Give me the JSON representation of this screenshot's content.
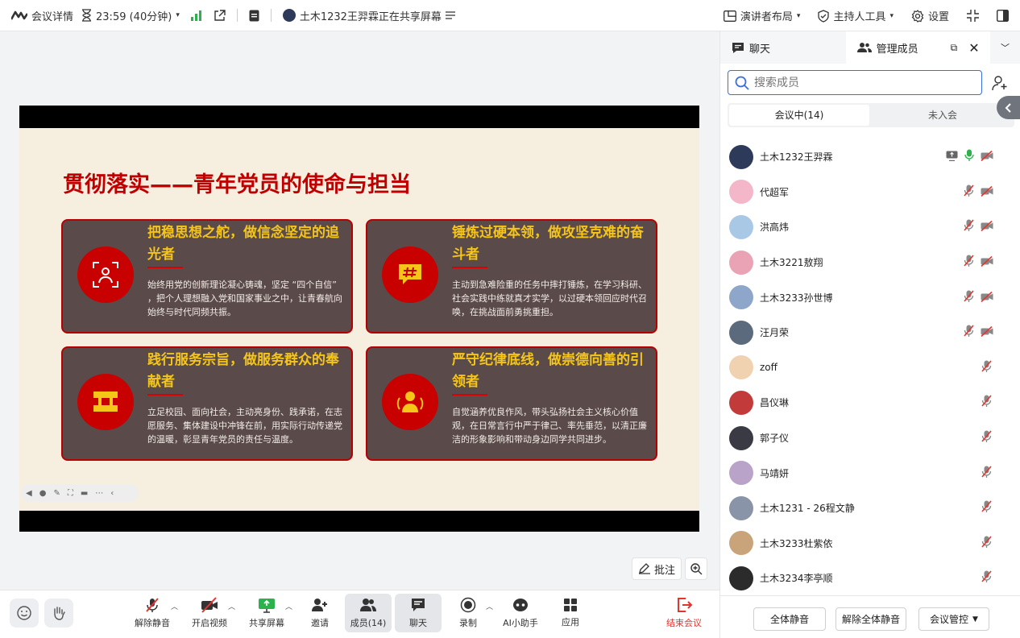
{
  "topbar": {
    "meeting_details": "会议详情",
    "timer": "23:59 (40分钟)",
    "sharing_status": "土木1232王羿霖正在共享屏幕",
    "presenter_layout": "演讲者布局",
    "host_tools": "主持人工具",
    "settings": "设置"
  },
  "slide": {
    "title": "贯彻落实——青年党员的使命与担当",
    "cards": [
      {
        "title": "把稳思想之舵，做信念坚定的追光者",
        "body": "始终用党的创新理论凝心铸魂，坚定 “四个自信” ，把个人理想融入党和国家事业之中，让青春航向始终与时代同频共振。",
        "icon": "focus-person-icon"
      },
      {
        "title": "锤炼过硬本领，做攻坚克难的奋斗者",
        "body": "主动到急难险重的任务中摔打锤炼，在学习科研、社会实践中练就真才实学，以过硬本领回应时代召唤，在挑战面前勇挑重担。",
        "icon": "hashtag-chat-icon"
      },
      {
        "title": "践行服务宗旨，做服务群众的奉献者",
        "body": "立足校园、面向社会，主动亮身份、践承诺，在志愿服务、集体建设中冲锋在前，用实际行动传递党的温暖，彰显青年党员的责任与温度。",
        "icon": "service-sign-icon"
      },
      {
        "title": "严守纪律底线，做崇德向善的引领者",
        "body": "自觉涵养优良作风，带头弘扬社会主义核心价值观，在日常言行中严于律己、率先垂范，以清正廉洁的形象影响和带动身边同学共同进步。",
        "icon": "leader-person-icon"
      }
    ]
  },
  "annotate": "批注",
  "bottom": {
    "unmute": "解除静音",
    "start_video": "开启视频",
    "share_screen": "共享屏幕",
    "invite": "邀请",
    "members": "成员(14)",
    "chat": "聊天",
    "record": "录制",
    "ai_assistant": "AI小助手",
    "apps": "应用",
    "end_meeting": "结束会议"
  },
  "panel": {
    "tab_chat": "聊天",
    "tab_members": "管理成员",
    "search_placeholder": "搜索成员",
    "seg_in_meeting": "会议中(14)",
    "seg_not_joined": "未入会",
    "members": [
      {
        "name": "土木1232王羿霖",
        "avatar_color": "#2d3a5a",
        "sharing": true,
        "mic_on": true,
        "cam_off": true
      },
      {
        "name": "代超军",
        "avatar_color": "#f4b6c9",
        "sharing": false,
        "mic_on": false,
        "cam_off": true
      },
      {
        "name": "洪高炜",
        "avatar_color": "#a9c8e6",
        "sharing": false,
        "mic_on": false,
        "cam_off": true
      },
      {
        "name": "土木3221敖翔",
        "avatar_color": "#e9a3b5",
        "sharing": false,
        "mic_on": false,
        "cam_off": true
      },
      {
        "name": "土木3233孙世博",
        "avatar_color": "#8ea6c9",
        "sharing": false,
        "mic_on": false,
        "cam_off": true
      },
      {
        "name": "汪月荣",
        "avatar_color": "#5b6a7c",
        "sharing": false,
        "mic_on": false,
        "cam_off": true
      },
      {
        "name": "zoff",
        "avatar_color": "#f0d2b0",
        "sharing": false,
        "mic_on": false,
        "cam_off": false
      },
      {
        "name": "昌仪琳",
        "avatar_color": "#c23a3a",
        "sharing": false,
        "mic_on": false,
        "cam_off": false
      },
      {
        "name": "郭子仪",
        "avatar_color": "#3a3a44",
        "sharing": false,
        "mic_on": false,
        "cam_off": false
      },
      {
        "name": "马靖妍",
        "avatar_color": "#b9a3c8",
        "sharing": false,
        "mic_on": false,
        "cam_off": false
      },
      {
        "name": "土木1231 - 26程文静",
        "avatar_color": "#8a94a8",
        "sharing": false,
        "mic_on": false,
        "cam_off": false
      },
      {
        "name": "土木3233杜紫依",
        "avatar_color": "#c9a47a",
        "sharing": false,
        "mic_on": false,
        "cam_off": false
      },
      {
        "name": "土木3234李亭顺",
        "avatar_color": "#2b2b2b",
        "sharing": false,
        "mic_on": false,
        "cam_off": false
      }
    ],
    "mute_all": "全体静音",
    "unmute_all": "解除全体静音",
    "meeting_control": "会议管控"
  },
  "colors": {
    "accent": "#3b6fe0",
    "end_red": "#e3342f",
    "slide_red": "#c00000",
    "card_gold": "#f5c518"
  }
}
